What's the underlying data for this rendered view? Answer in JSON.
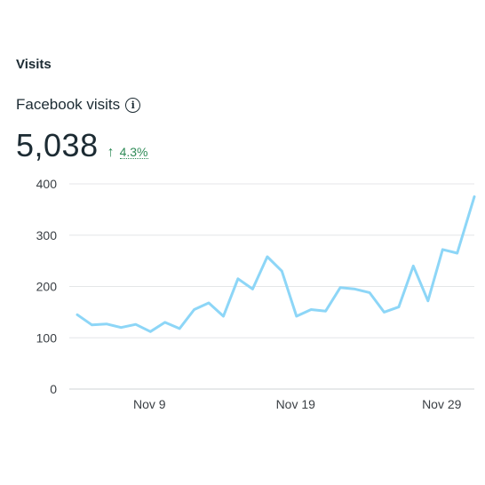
{
  "section": {
    "title": "Visits"
  },
  "metric": {
    "label": "Facebook visits",
    "info_icon": "info-icon",
    "value": "5,038",
    "change": "4.3%",
    "change_direction": "up",
    "change_color": "#2e8b57"
  },
  "chart_data": {
    "type": "line",
    "title": "",
    "xlabel": "",
    "ylabel": "",
    "ylim": [
      0,
      400
    ],
    "y_ticks": [
      "0",
      "100",
      "200",
      "300",
      "400"
    ],
    "x_tick_labels": [
      {
        "label": "Nov 9",
        "index": 5
      },
      {
        "label": "Nov 19",
        "index": 15
      },
      {
        "label": "Nov 29",
        "index": 25
      }
    ],
    "x": [
      "Nov 4",
      "Nov 5",
      "Nov 6",
      "Nov 7",
      "Nov 8",
      "Nov 9",
      "Nov 10",
      "Nov 11",
      "Nov 12",
      "Nov 13",
      "Nov 14",
      "Nov 15",
      "Nov 16",
      "Nov 17",
      "Nov 18",
      "Nov 19",
      "Nov 20",
      "Nov 21",
      "Nov 22",
      "Nov 23",
      "Nov 24",
      "Nov 25",
      "Nov 26",
      "Nov 27",
      "Nov 28",
      "Nov 29",
      "Nov 30"
    ],
    "series": [
      {
        "color": "#8dd6f7",
        "values": [
          145,
          125,
          127,
          120,
          126,
          112,
          130,
          118,
          155,
          168,
          142,
          215,
          195,
          258,
          230,
          142,
          155,
          152,
          198,
          195,
          188,
          150,
          160,
          240,
          172,
          272,
          265
        ]
      }
    ],
    "final_value": 375,
    "grid": true,
    "legend": "none"
  }
}
